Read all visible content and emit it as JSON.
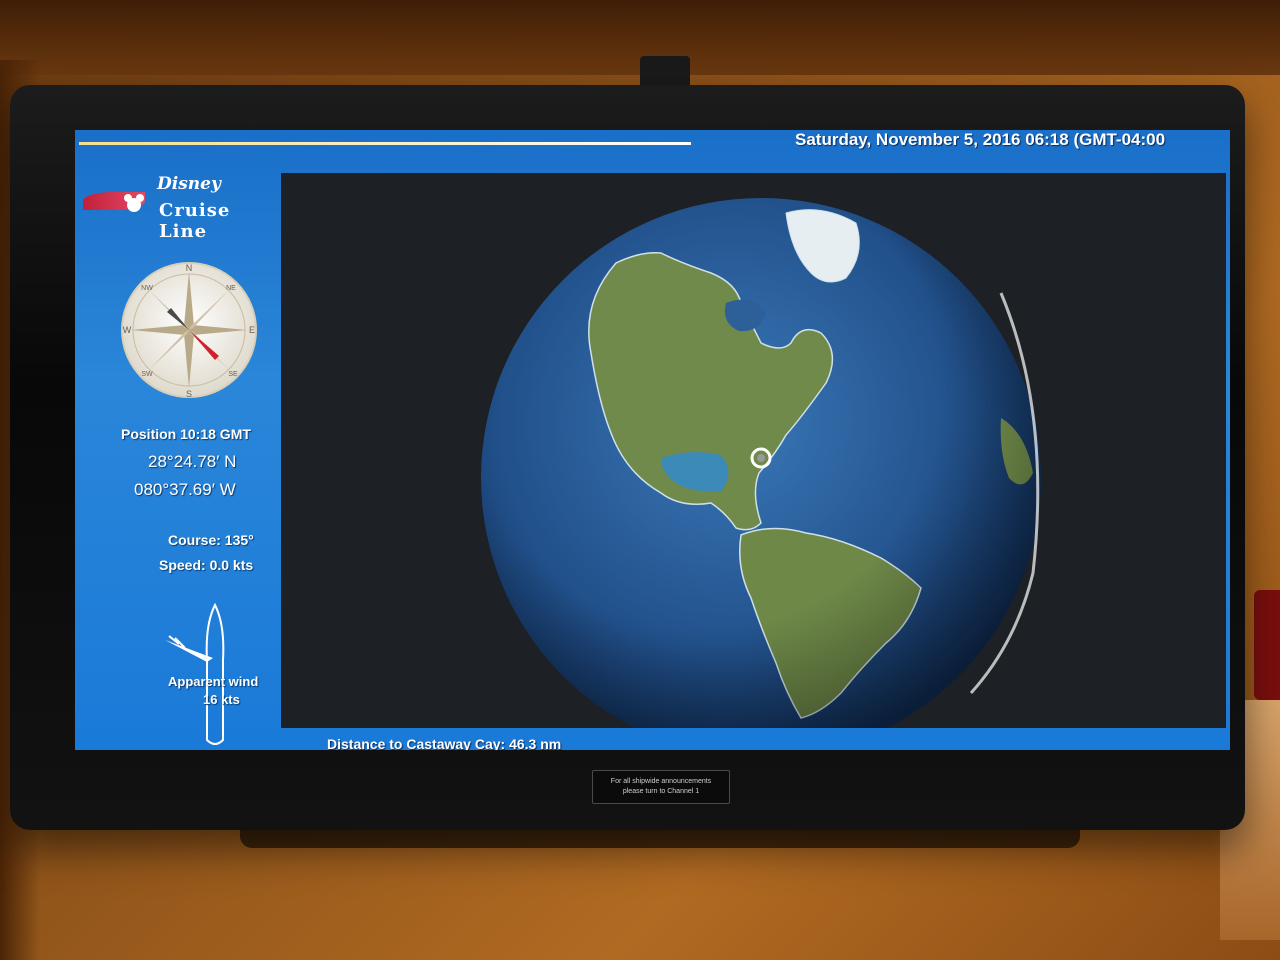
{
  "header": {
    "datetime": "Saturday, November 5, 2016 06:18 (GMT-04:00"
  },
  "logo": {
    "brand_line1": "Disney",
    "brand_line2": "Cruise Line"
  },
  "compass": {
    "points": [
      "N",
      "NE",
      "E",
      "SE",
      "S",
      "SW",
      "W",
      "NW"
    ]
  },
  "navigation": {
    "position_label": "Position 10:18 GMT",
    "latitude": "28°24.78′ N",
    "longitude": "080°37.69′ W",
    "course": "Course: 135°",
    "speed": "Speed: 0.0 kts",
    "apparent_wind_label": "Apparent wind",
    "apparent_wind_speed": "16 kts"
  },
  "map": {
    "marker": "ship-position-marker",
    "distance_text": "Distance to Castaway Cay: 46.3 nm"
  },
  "placard": {
    "line1": "For all shipwide announcements",
    "line2": "please turn to Channel 1"
  },
  "colors": {
    "screen_blue": "#1a7ad8",
    "ocean": "#2a5f9a",
    "land_green": "#6f8a4a",
    "map_background": "#1d2024"
  }
}
